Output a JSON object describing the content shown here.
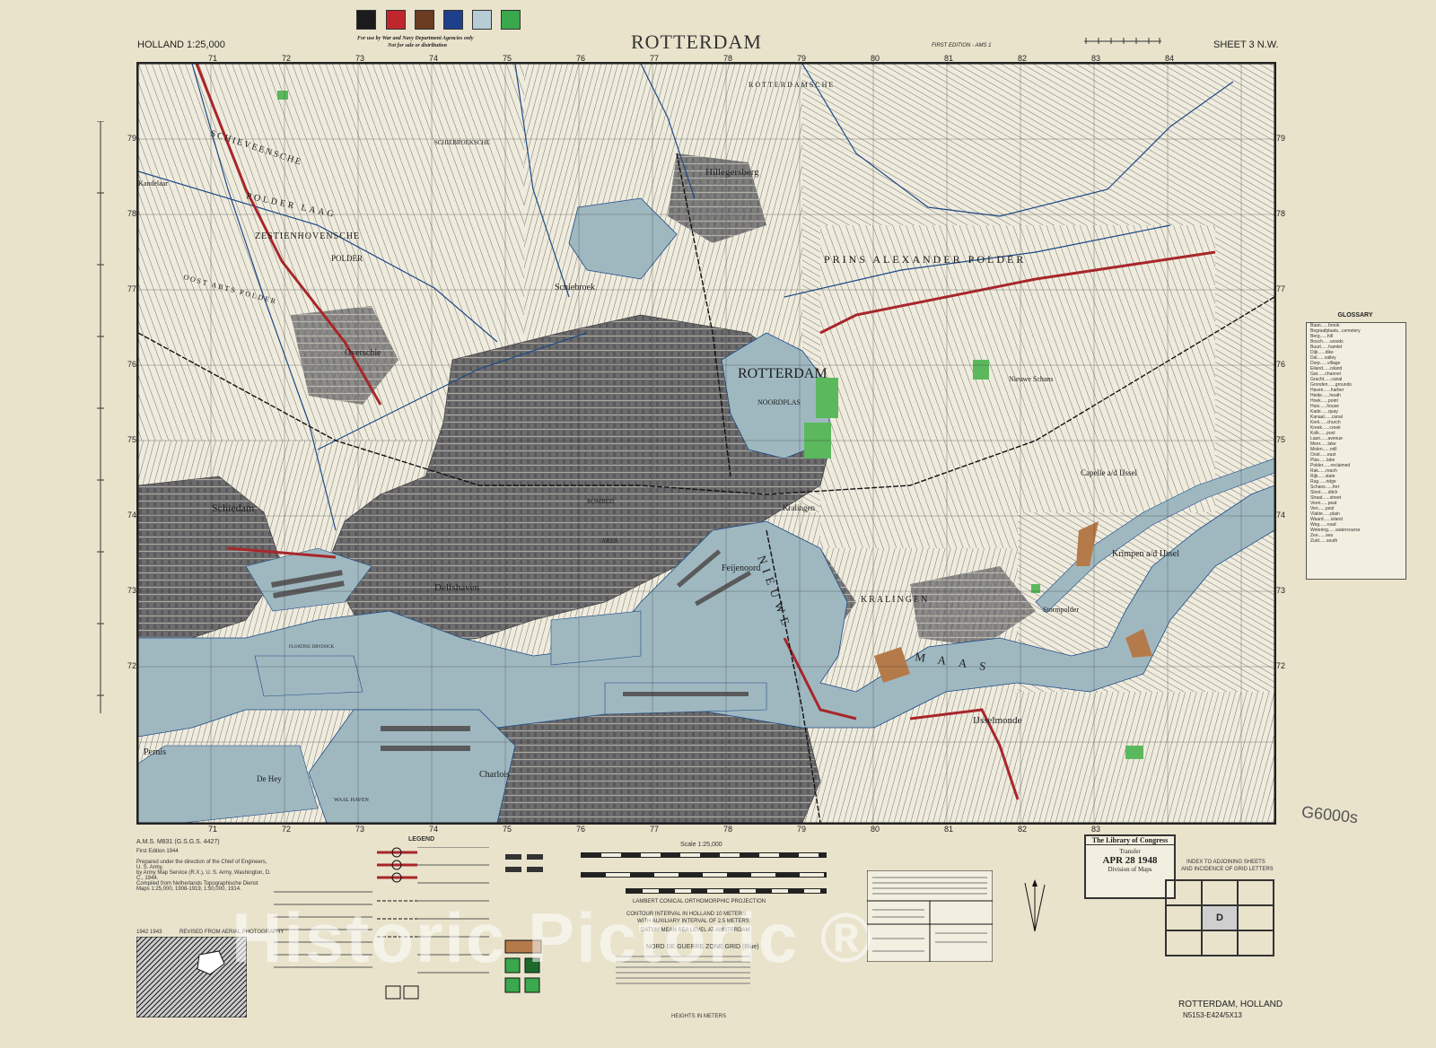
{
  "header": {
    "series_label": "HOLLAND 1:25,000",
    "restriction_line1": "For use by War and Navy Department Agencies only",
    "restriction_line2": "Not for sale or distribution",
    "title": "ROTTERDAM",
    "edition": "FIRST EDITION - AMS 1",
    "sheet": "SHEET 3 N.W.",
    "color_swatches": [
      "#1b1b1b",
      "#c0272d",
      "#6b3b22",
      "#1e3f8a",
      "#b7cdd6",
      "#3aa84c"
    ]
  },
  "map": {
    "colors": {
      "water": "#9fb8c0",
      "urban": "#6f6f70",
      "land": "#eeeadb",
      "green": "#5bb85d",
      "road_red": "#a8262a",
      "canal": "#1d4a86"
    },
    "place_names": {
      "rotterdam": "ROTTERDAM",
      "noordplas": "NOORDPLAS",
      "schiedam": "Schiedam",
      "hillegersberg": "Hillegersberg",
      "schiebroek": "Schiebroek",
      "overschie": "Overschie",
      "delfshaven": "Delfshaven",
      "feijenoord": "Feijenoord",
      "kralingen": "Kralingen",
      "ijsselmonde": "IJsselmonde",
      "charlois": "Charlois",
      "pernis": "Pernis",
      "krimpen": "Krimpen a/d IJssel",
      "capelle": "Capelle a/d IJssel",
      "nieuwe_schans": "Nieuwe Schans",
      "stormpolder": "Stormpolder",
      "kandelaar": "Kandelaar",
      "de_hey": "De Hey",
      "nieuwe_maas_1": "NIEUWE",
      "nieuwe_maas_2": "MAAS",
      "prins_alexander_polder": "PRINS ALEXANDER POLDER",
      "schieveensche": "SCHIEVEENSCHE",
      "polder_laag": "POLDER LAAG",
      "zestienhovensche": "ZESTIENHOVENSCHE",
      "polder": "POLDER",
      "oost_abts": "OOST ABTS POLDER",
      "rotterdamsche": "ROTTERDAMSCHE",
      "schiebroeksche": "SCHIEBROEKSCHE",
      "bombed": "BOMBED",
      "area": "AREA",
      "waalhaven": "WAAL HAVEN",
      "floating_drydock": "FLOATING DRYDOCK",
      "kralingen_polder": "KRALINGEN"
    },
    "grid_eastings": [
      "71",
      "72",
      "73",
      "74",
      "75",
      "76",
      "77",
      "78",
      "79",
      "80",
      "81",
      "82",
      "83",
      "84"
    ],
    "grid_northings": [
      "79",
      "78",
      "77",
      "76",
      "75",
      "74",
      "73",
      "72"
    ]
  },
  "glossary": {
    "title": "GLOSSARY",
    "entries": [
      "Baan......brook",
      "Begraafplaats...cemetery",
      "Berg......hill",
      "Bosch......woods",
      "Buurt......hamlet",
      "Dijk......dike",
      "Dal......valley",
      "Dorp......village",
      "Eiland......island",
      "Gat......channel",
      "Gracht......canal",
      "Gronden......grounds",
      "Haven......harbor",
      "Heide......heath",
      "Hoek......point",
      "Huis......house",
      "Kade......quay",
      "Kanaal......canal",
      "Kerk......church",
      "Kreek......creek",
      "Kolk......pool",
      "Laan......avenue",
      "Meer......lake",
      "Molen......mill",
      "Oost......east",
      "Plas......lake",
      "Polder......reclaimed",
      "Rak......reach",
      "Rijk......state",
      "Rug......ridge",
      "Schans......fort",
      "Sloot......ditch",
      "Straat......street",
      "Veen......peat",
      "Ven......pool",
      "Vlakte......plain",
      "Waard......island",
      "Weg......road",
      "Wetering......watercourse",
      "Zee......sea",
      "Zuid......south"
    ]
  },
  "footer": {
    "ams": "A.M.S. M831 (G.S.G.S. 4427)",
    "first_edition": "First Edition 1944",
    "notes": [
      "Prepared under the direction of the Chief of Engineers, U. S. Army,",
      "by Army Map Service (R.X.), U. S. Army, Washington, D. C., 1944.",
      "Compiled from Netherlands Topographische Dienst",
      "Maps 1:25,000, 1908-1919, 1:50,000, 1914."
    ],
    "legend_title": "LEGEND",
    "scale_title": "Scale 1:25,000",
    "projection": "LAMBERT CONICAL ORTHOMORPHIC PROJECTION",
    "contour_line1": "CONTOUR INTERVAL IN HOLLAND 10 METERS",
    "contour_line2": "WITH AUXILIARY INTERVAL OF 2.5 METERS",
    "datum": "DATUM MEAN SEA LEVEL AT AMSTERDAM",
    "grid_title": "NORD DE GUERRE ZONE GRID (Blue)",
    "heights": "HEIGHTS IN METERS",
    "photo_label": "REVISED FROM AERIAL PHOTOGRAPHY",
    "photo_years": "1942   1943",
    "place": "ROTTERDAM, HOLLAND",
    "sheet_code": "N5153-E424/5X13",
    "index_title": "INDEX TO ADJOINING SHEETS",
    "index_sub": "AND INCIDENCE OF GRID LETTERS",
    "index_letter": "D",
    "watermark": "Historic Pictoric ®",
    "handnote": "G6000s"
  },
  "stamp": {
    "line1": "The Library of Congress",
    "line2": "Transfer",
    "line3": "APR 28 1948",
    "line4": "Division of Maps"
  }
}
